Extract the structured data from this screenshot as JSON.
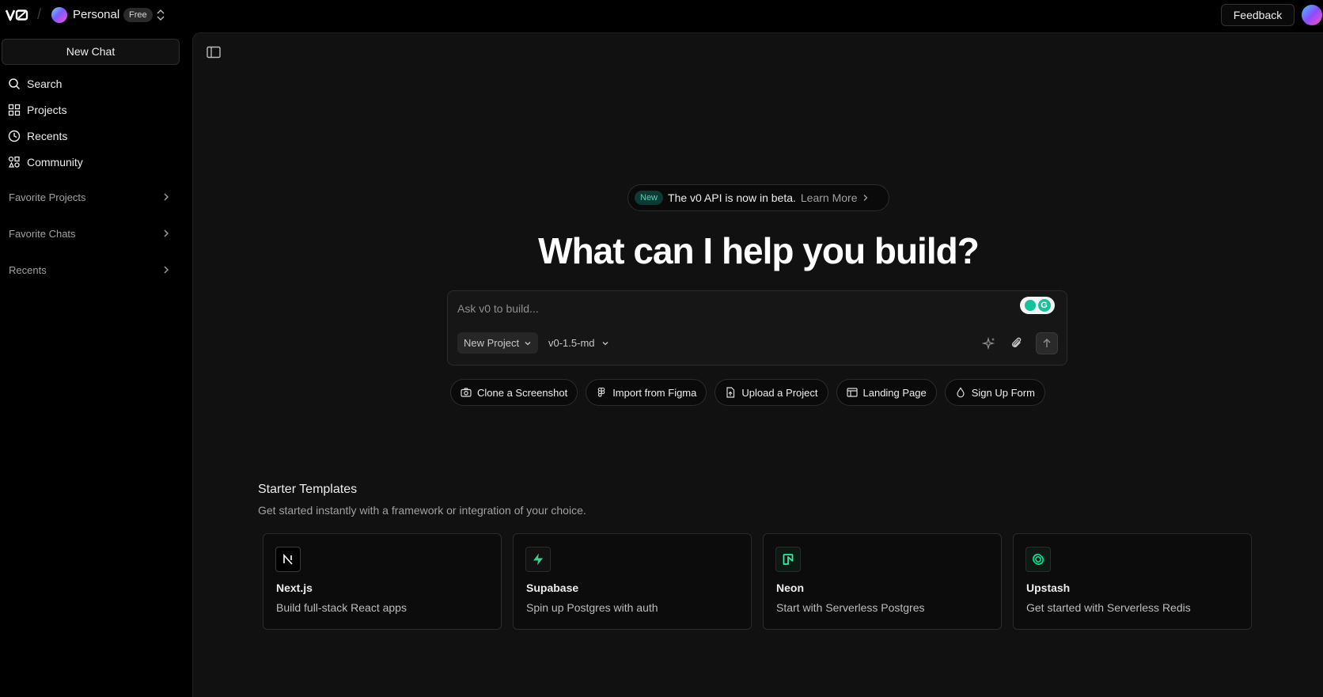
{
  "topbar": {
    "logo": "v0-logo",
    "workspace_name": "Personal",
    "workspace_badge": "Free",
    "feedback_label": "Feedback"
  },
  "sidebar": {
    "new_chat_label": "New Chat",
    "nav": [
      {
        "label": "Search",
        "icon": "search-icon"
      },
      {
        "label": "Projects",
        "icon": "grid-icon"
      },
      {
        "label": "Recents",
        "icon": "clock-icon"
      },
      {
        "label": "Community",
        "icon": "community-icon"
      }
    ],
    "sections": [
      {
        "label": "Favorite Projects"
      },
      {
        "label": "Favorite Chats"
      },
      {
        "label": "Recents"
      }
    ]
  },
  "main": {
    "announcement": {
      "badge": "New",
      "message": "The v0 API is now in beta.",
      "link": "Learn More"
    },
    "headline": "What can I help you build?",
    "composer": {
      "placeholder": "Ask v0 to build...",
      "project_select": "New Project",
      "model_select": "v0-1.5-md"
    },
    "suggestions": [
      {
        "label": "Clone a Screenshot",
        "icon": "camera-icon"
      },
      {
        "label": "Import from Figma",
        "icon": "figma-icon"
      },
      {
        "label": "Upload a Project",
        "icon": "file-upload-icon"
      },
      {
        "label": "Landing Page",
        "icon": "layout-icon"
      },
      {
        "label": "Sign Up Form",
        "icon": "droplet-icon"
      }
    ],
    "starter": {
      "title": "Starter Templates",
      "subtitle": "Get started instantly with a framework or integration of your choice.",
      "cards": [
        {
          "title": "Next.js",
          "description": "Build full-stack React apps",
          "icon": "nextjs-icon"
        },
        {
          "title": "Supabase",
          "description": "Spin up Postgres with auth",
          "icon": "supabase-icon"
        },
        {
          "title": "Neon",
          "description": "Start with Serverless Postgres",
          "icon": "neon-icon"
        },
        {
          "title": "Upstash",
          "description": "Get started with Serverless Redis",
          "icon": "upstash-icon"
        }
      ]
    }
  },
  "colors": {
    "background": "#000000",
    "panel": "#111111",
    "accent_green": "#3ecf8e",
    "new_badge": "#4fd1b5"
  }
}
